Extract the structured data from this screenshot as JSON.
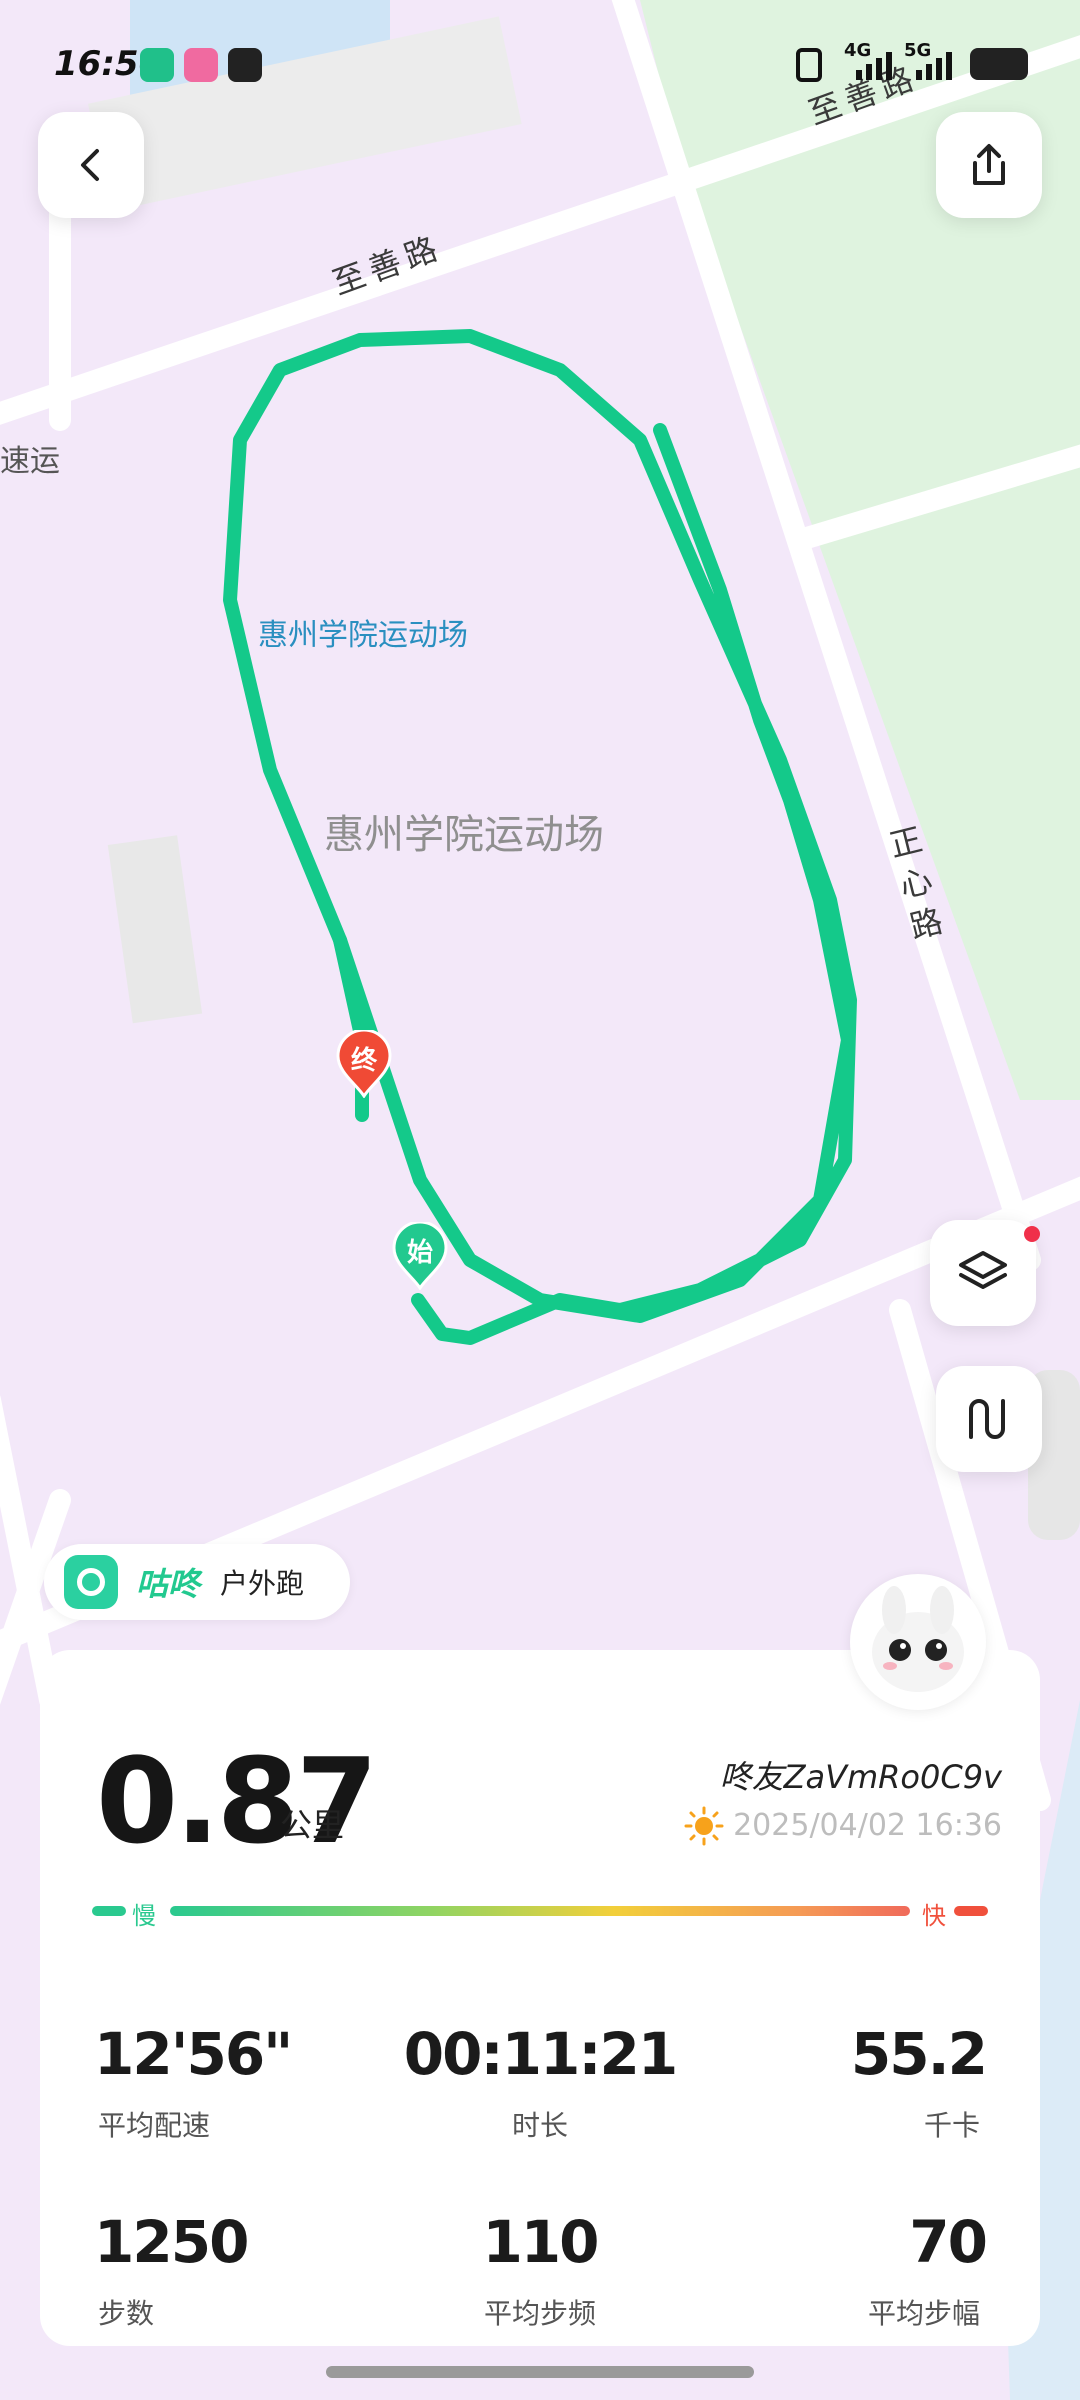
{
  "status_bar": {
    "time": "16:50",
    "network_1": "4G",
    "network_2": "5G"
  },
  "map": {
    "road_labels": [
      "至善路",
      "至善路",
      "正心路"
    ],
    "partial_label": "速运",
    "venue_small": "惠州学院运动场",
    "venue_large": "惠州学院运动场",
    "end_marker": "终",
    "start_marker": "始",
    "route_color": "#14c98a"
  },
  "controls": {
    "back_icon": "chevron-left-icon",
    "share_icon": "share-icon",
    "layers_icon": "layers-icon",
    "route_icon": "route-icon"
  },
  "brand": {
    "name": "咕咚",
    "activity": "户外跑"
  },
  "summary": {
    "distance": "0.87",
    "distance_unit": "公里",
    "user": "咚友ZaVmRo0C9v",
    "datetime": "2025/04/02 16:36",
    "weather_icon": "sun-icon",
    "pace_slow": "慢",
    "pace_fast": "快"
  },
  "stats": [
    {
      "value": "12'56\"",
      "label": "平均配速"
    },
    {
      "value": "00:11:21",
      "label": "时长"
    },
    {
      "value": "55.2",
      "label": "千卡"
    },
    {
      "value": "1250",
      "label": "步数"
    },
    {
      "value": "110",
      "label": "平均步频"
    },
    {
      "value": "70",
      "label": "平均步幅"
    }
  ],
  "colors": {
    "accent": "#22c98f",
    "slow": "#2ac98f",
    "fast": "#f0503c"
  }
}
